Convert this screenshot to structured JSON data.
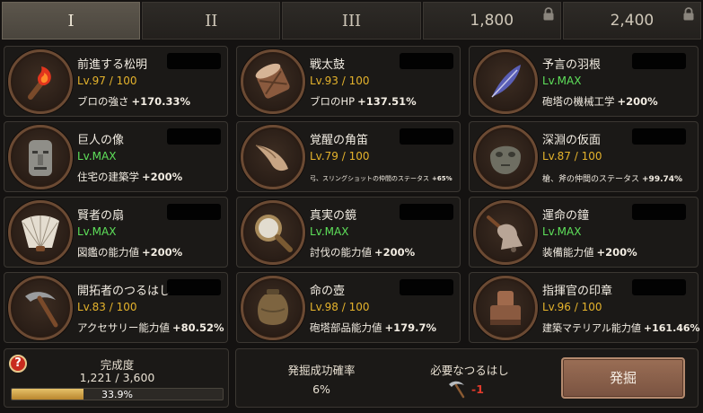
{
  "tabs": [
    {
      "label": "I",
      "locked": false,
      "active": true
    },
    {
      "label": "II",
      "locked": false,
      "active": false
    },
    {
      "label": "III",
      "locked": false,
      "active": false
    },
    {
      "label": "1,800",
      "locked": true,
      "active": false
    },
    {
      "label": "2,400",
      "locked": true,
      "active": false
    }
  ],
  "items": [
    {
      "name": "前進する松明",
      "level": "Lv.97 / 100",
      "effect": "ブロの強さ",
      "value": "+170.33%",
      "icon": "torch-icon"
    },
    {
      "name": "戦太鼓",
      "level": "Lv.93 / 100",
      "effect": "ブロのHP",
      "value": "+137.51%",
      "icon": "war-drum-icon"
    },
    {
      "name": "予言の羽根",
      "level": "Lv.MAX",
      "effect": "砲塔の機械工学",
      "value": "+200%",
      "icon": "feather-icon"
    },
    {
      "name": "巨人の像",
      "level": "Lv.MAX",
      "effect": "住宅の建築学",
      "value": "+200%",
      "icon": "giant-statue-icon"
    },
    {
      "name": "覚醒の角笛",
      "level": "Lv.79 / 100",
      "effect": "弓、スリングショットの仲間のステータス",
      "value": "+65%",
      "icon": "horn-icon"
    },
    {
      "name": "深淵の仮面",
      "level": "Lv.87 / 100",
      "effect": "槍、斧の仲間のステータス",
      "value": "+99.74%",
      "icon": "stone-mask-icon"
    },
    {
      "name": "賢者の扇",
      "level": "Lv.MAX",
      "effect": "図鑑の能力値",
      "value": "+200%",
      "icon": "fan-icon"
    },
    {
      "name": "真実の鏡",
      "level": "Lv.MAX",
      "effect": "討伐の能力値",
      "value": "+200%",
      "icon": "mirror-icon"
    },
    {
      "name": "運命の鐘",
      "level": "Lv.MAX",
      "effect": "装備能力値",
      "value": "+200%",
      "icon": "bell-icon"
    },
    {
      "name": "開拓者のつるはし",
      "level": "Lv.83 / 100",
      "effect": "アクセサリー能力値",
      "value": "+80.52%",
      "icon": "pickaxe-icon"
    },
    {
      "name": "命の壺",
      "level": "Lv.98 / 100",
      "effect": "砲塔部品能力値",
      "value": "+179.7%",
      "icon": "jar-icon"
    },
    {
      "name": "指揮官の印章",
      "level": "Lv.96 / 100",
      "effect": "建築マテリアル能力値",
      "value": "+161.46%",
      "icon": "seal-icon"
    }
  ],
  "progress": {
    "title": "完成度",
    "count": "1,221 / 3,600",
    "percent_text": "33.9%",
    "fraction": 0.339
  },
  "dig": {
    "rate_label": "発掘成功確率",
    "rate_value": "6%",
    "pickaxe_label": "必要なつるはし",
    "pickaxe_value": "-1",
    "button_label": "発掘"
  },
  "colors": {
    "level_normal": "#e5b32c",
    "level_max": "#5ee05a",
    "cost_negative": "#e03a2c"
  }
}
